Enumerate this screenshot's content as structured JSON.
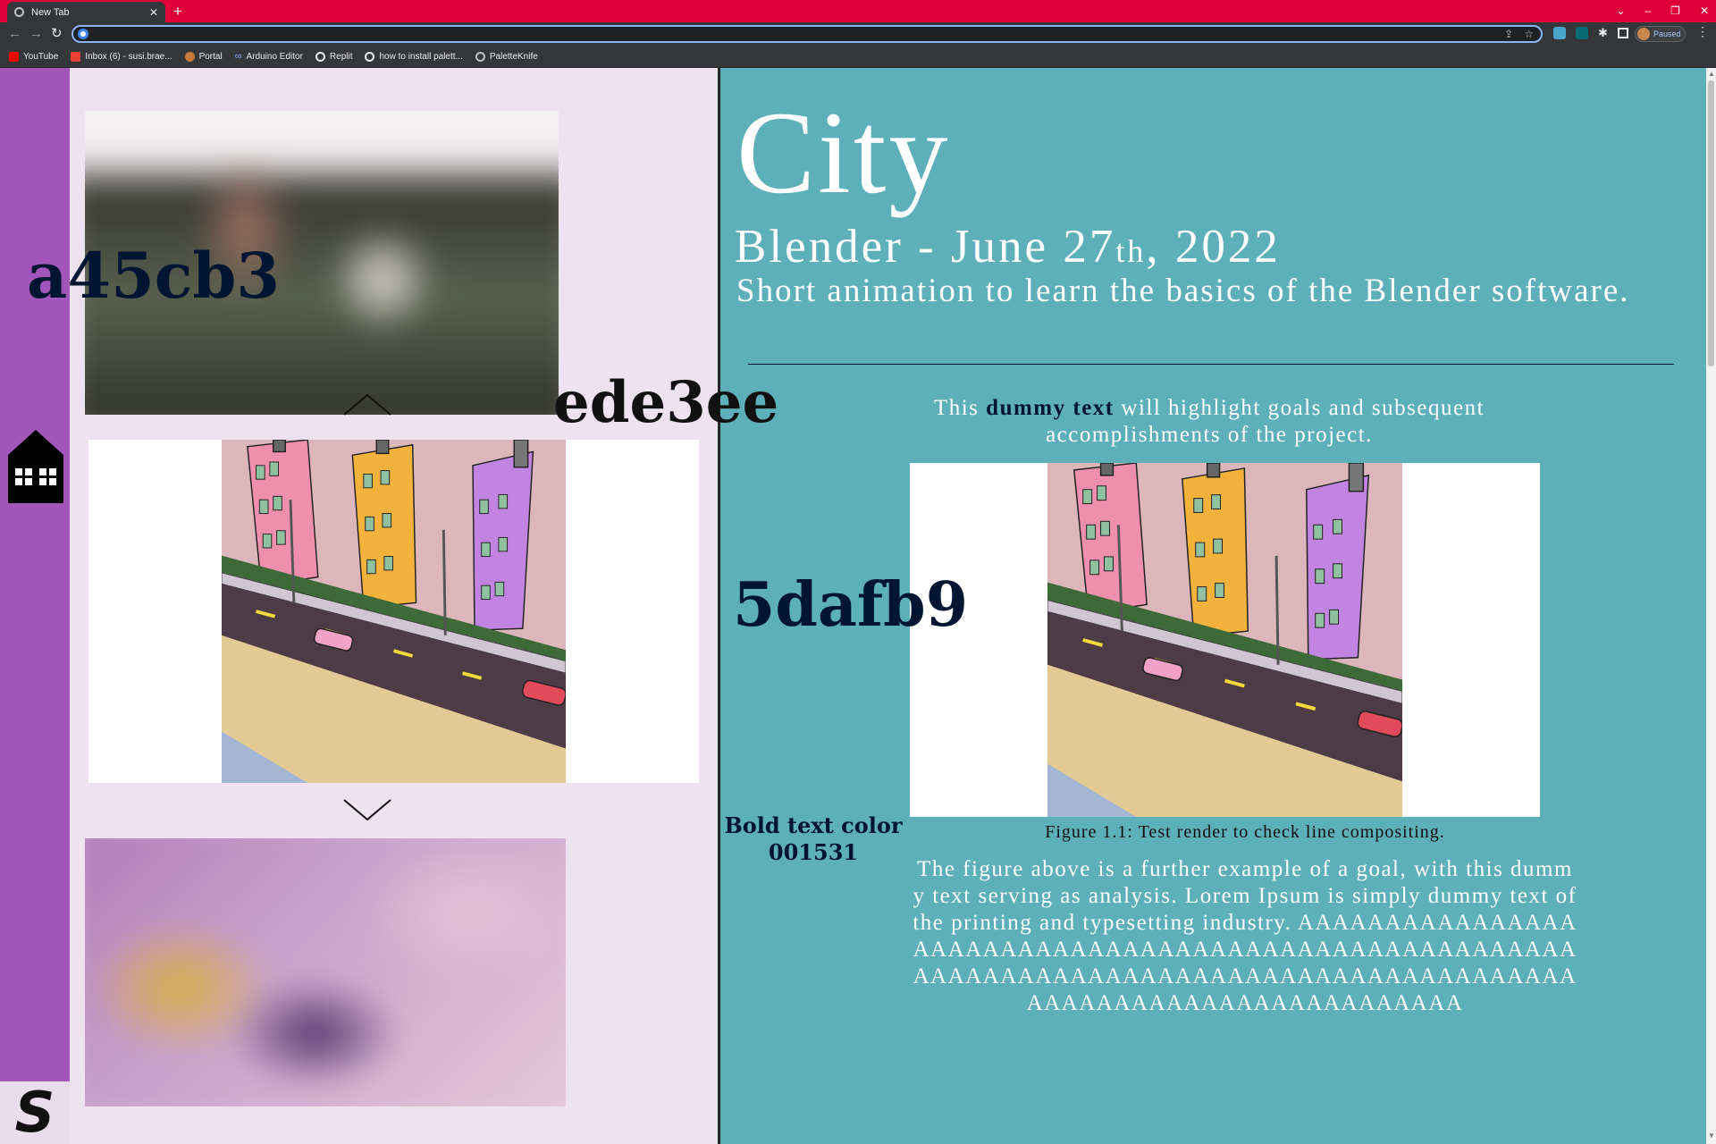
{
  "browser": {
    "tab_title": "New Tab",
    "tab_close": "✕",
    "new_tab": "+",
    "window_controls": [
      "⌄",
      "–",
      "❐",
      "✕"
    ],
    "address_value": "",
    "profile_status": "Paused",
    "bookmarks": [
      {
        "label": "YouTube",
        "color": "#ff0000"
      },
      {
        "label": "Inbox (6) - susi.brae...",
        "color": "#ea4335"
      },
      {
        "label": "Portal",
        "color": "#c77a3a"
      },
      {
        "label": "Arduino Editor",
        "color": "#8ab4f8"
      },
      {
        "label": "Replit",
        "color": "#e8eaed"
      },
      {
        "label": "how to install palett...",
        "color": "#e8eaed"
      },
      {
        "label": "PaletteKnife",
        "color": "#bdc1c6"
      }
    ]
  },
  "sidebar": {
    "color": "#a356b9",
    "home_icon": "house-icon",
    "logo_letter": "S"
  },
  "gallery": {
    "background": "#ede2ee",
    "up_icon": "chevron-up-icon",
    "down_icon": "chevron-down-icon"
  },
  "content": {
    "background": "#5dafb9",
    "title": "City",
    "subtitle_pre": "Blender - June 27",
    "subtitle_sup": "th",
    "subtitle_post": ", 2022",
    "description": "Short animation to learn the basics of the Blender software.",
    "intro_pre": "This ",
    "intro_bold": "dummy text",
    "intro_post": " will highlight goals and subsequent accomplishments of the project.",
    "figure_caption": "Figure 1.1: Test render to check line compositing.",
    "analysis": "The figure above is a further example of a goal, with this dummy text serving as analysis. Lorem Ipsum is simply dummy text of the printing and typesetting industry. AAAAAAAAAAAAAAAAAAAAAAAAAAAAAAAAAAAAAAAAAAAAAAAAAAAAAAAAAAAAAAAAAAAAAAAAAAAAAAAAAAAAAAAAAAAAAAAAAAAAAAAAAAAAAAAAAAAAA"
  },
  "annotations": {
    "sidebar_hex": "a45cb3",
    "gallery_hex": "ede3ee",
    "content_hex": "5dafb9",
    "bold_note_line1": "Bold text color",
    "bold_note_line2": "001531"
  }
}
